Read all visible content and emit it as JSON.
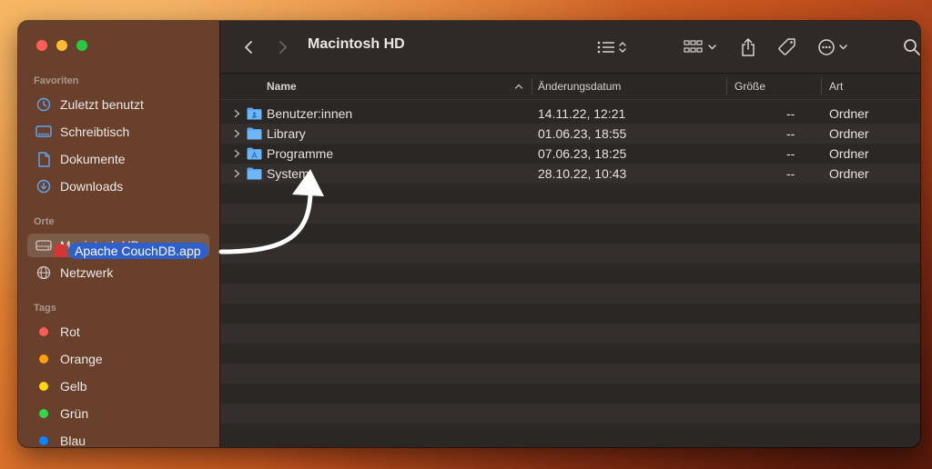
{
  "window": {
    "title": "Macintosh HD"
  },
  "sidebar": {
    "favorites_header": "Favoriten",
    "favorites": [
      {
        "label": "Zuletzt benutzt",
        "icon": "clock-icon"
      },
      {
        "label": "Schreibtisch",
        "icon": "desktop-icon"
      },
      {
        "label": "Dokumente",
        "icon": "document-icon"
      },
      {
        "label": "Downloads",
        "icon": "download-icon"
      }
    ],
    "places_header": "Orte",
    "places": [
      {
        "label": "Macintosh HD",
        "icon": "harddisk-icon",
        "selected": true
      },
      {
        "label": "Netzwerk",
        "icon": "globe-icon"
      }
    ],
    "tags_header": "Tags",
    "tags": [
      {
        "label": "Rot",
        "color": "#ff5b57"
      },
      {
        "label": "Orange",
        "color": "#ff9f0a"
      },
      {
        "label": "Gelb",
        "color": "#ffd60a"
      },
      {
        "label": "Grün",
        "color": "#32d74b"
      },
      {
        "label": "Blau",
        "color": "#0a84ff"
      }
    ]
  },
  "columns": {
    "name": "Name",
    "date": "Änderungsdatum",
    "size": "Größe",
    "kind": "Art"
  },
  "files": [
    {
      "name": "Benutzer:innen",
      "date": "14.11.22, 12:21",
      "size": "--",
      "kind": "Ordner"
    },
    {
      "name": "Library",
      "date": "01.06.23, 18:55",
      "size": "--",
      "kind": "Ordner"
    },
    {
      "name": "Programme",
      "date": "07.06.23, 18:25",
      "size": "--",
      "kind": "Ordner"
    },
    {
      "name": "System",
      "date": "28.10.22, 10:43",
      "size": "--",
      "kind": "Ordner"
    }
  ],
  "drag": {
    "label": "Apache CouchDB.app"
  },
  "colors": {
    "accent": "#2f5fc8",
    "folder": "#5aa7f0",
    "sidebar": "#6e422c"
  }
}
